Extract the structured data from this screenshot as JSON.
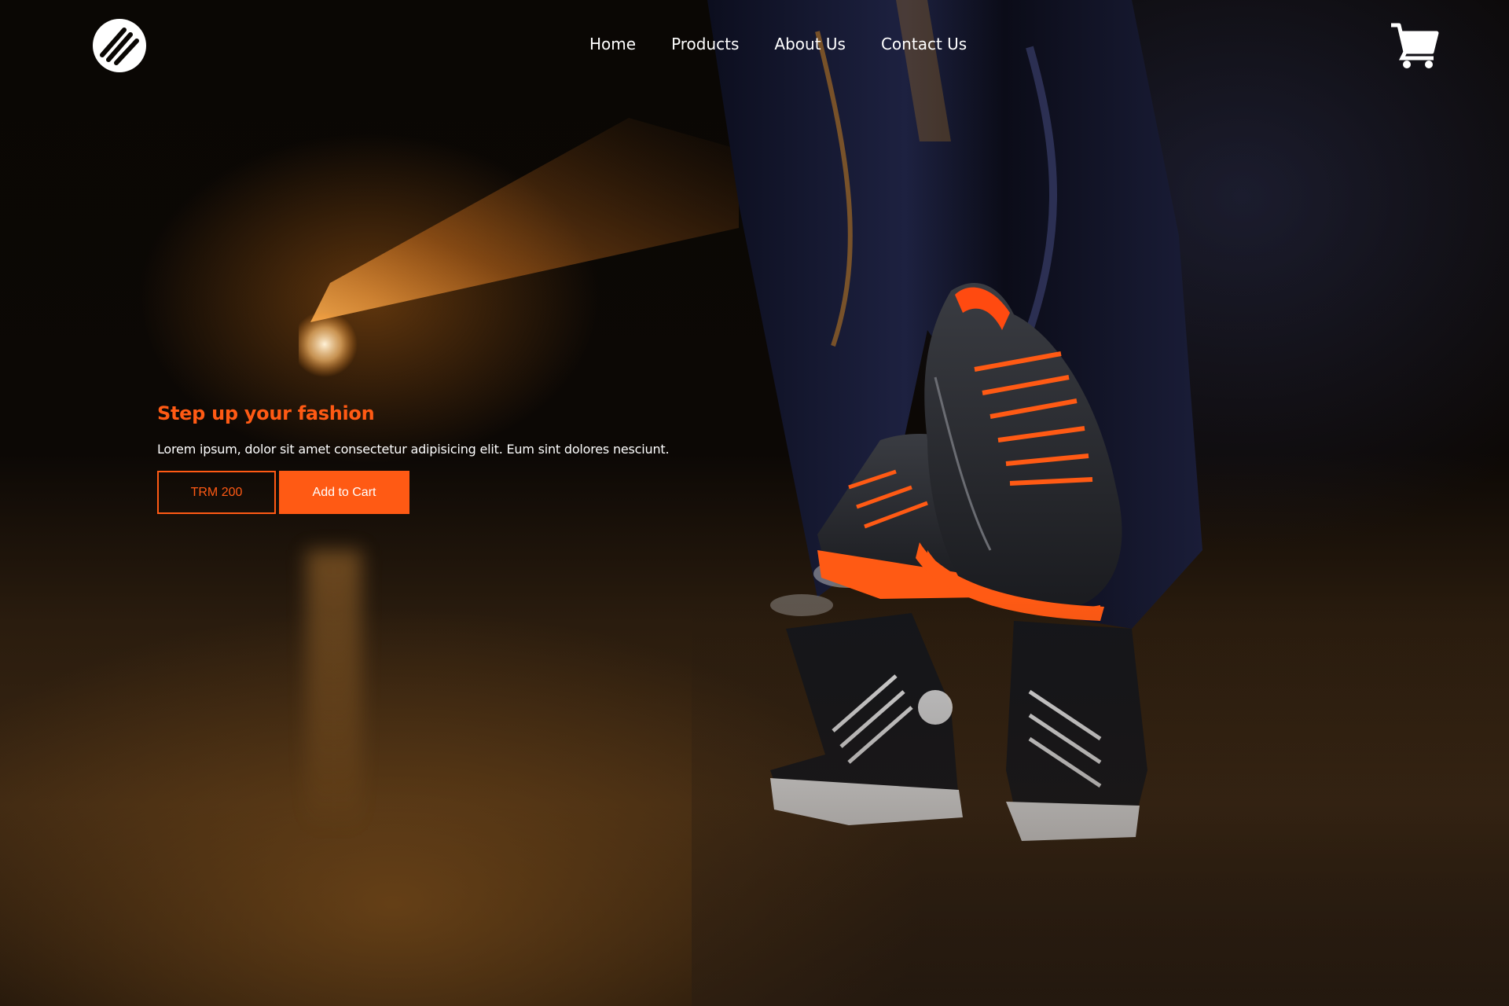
{
  "header": {
    "logo_icon": "stripes-logo-icon",
    "nav": [
      {
        "label": "Home"
      },
      {
        "label": "Products"
      },
      {
        "label": "About Us"
      },
      {
        "label": "Contact Us"
      }
    ],
    "cart_icon": "shopping-cart-icon"
  },
  "hero": {
    "title": "Step up your fashion",
    "text": "Lorem ipsum, dolor sit amet consectetur adipisicing elit. Eum sint dolores nesciunt.",
    "price_label": "TRM 200",
    "add_to_cart_label": "Add to Cart"
  },
  "theme": {
    "accent": "#ff5a14",
    "text": "#ffffff",
    "background": "#0a0704"
  }
}
